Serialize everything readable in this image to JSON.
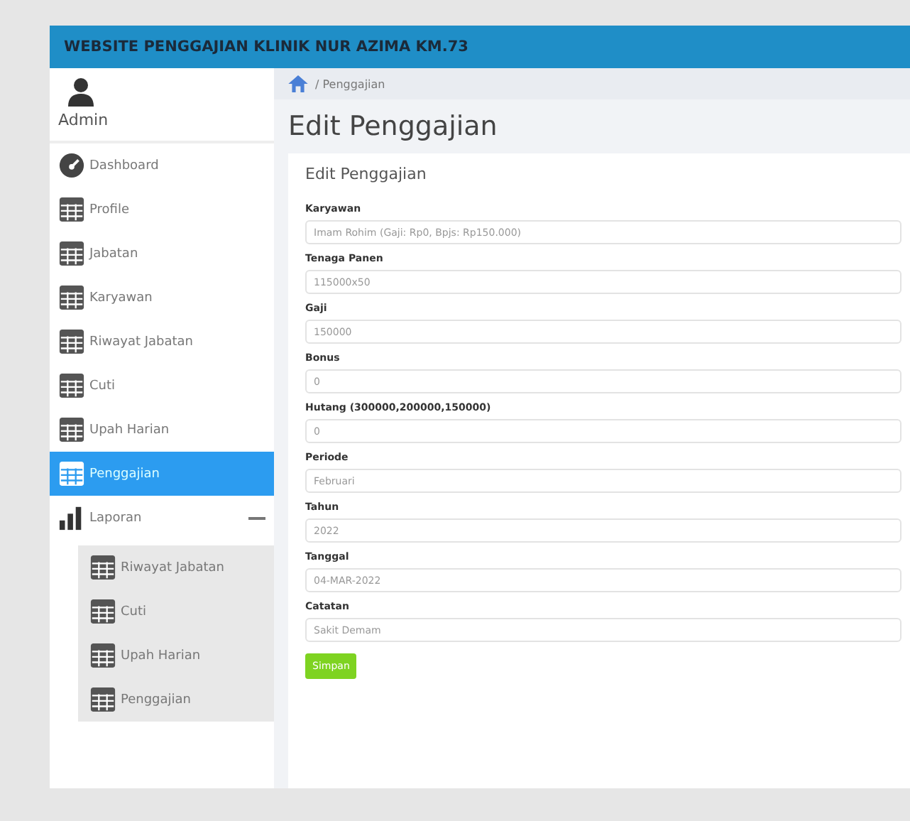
{
  "header": {
    "title": "WEBSITE PENGGAJIAN KLINIK NUR AZIMA KM.73"
  },
  "user": {
    "name": "Admin"
  },
  "sidebar": {
    "items": [
      {
        "label": "Dashboard",
        "kind": "dashboard",
        "selected": false
      },
      {
        "label": "Profile",
        "kind": "table",
        "selected": false
      },
      {
        "label": "Jabatan",
        "kind": "table",
        "selected": false
      },
      {
        "label": "Karyawan",
        "kind": "table",
        "selected": false
      },
      {
        "label": "Riwayat Jabatan",
        "kind": "table",
        "selected": false
      },
      {
        "label": "Cuti",
        "kind": "table",
        "selected": false
      },
      {
        "label": "Upah Harian",
        "kind": "table",
        "selected": false
      },
      {
        "label": "Penggajian",
        "kind": "table",
        "selected": true
      },
      {
        "label": "Laporan",
        "kind": "chart",
        "selected": false,
        "expanded": true,
        "children": [
          {
            "label": "Riwayat Jabatan",
            "selected": false
          },
          {
            "label": "Cuti",
            "selected": false
          },
          {
            "label": "Upah Harian",
            "selected": false
          },
          {
            "label": "Penggajian",
            "selected": false
          }
        ]
      }
    ]
  },
  "breadcrumb": "/ Penggajian",
  "page_title": "Edit Penggajian",
  "card": {
    "title": "Edit Penggajian",
    "fields": [
      {
        "label": "Karyawan",
        "value": "Imam Rohim (Gaji: Rp0, Bpjs: Rp150.000)"
      },
      {
        "label": "Tenaga Panen",
        "value": "115000x50"
      },
      {
        "label": "Gaji",
        "value": "150000"
      },
      {
        "label": "Bonus",
        "value": "0"
      },
      {
        "label": "Hutang (300000,200000,150000)",
        "value": "0"
      },
      {
        "label": "Periode",
        "value": "Februari"
      },
      {
        "label": "Tahun",
        "value": "2022"
      },
      {
        "label": "Tanggal",
        "value": "04-MAR-2022"
      },
      {
        "label": "Catatan",
        "value": "Sakit Demam"
      }
    ],
    "button": "Simpan"
  }
}
